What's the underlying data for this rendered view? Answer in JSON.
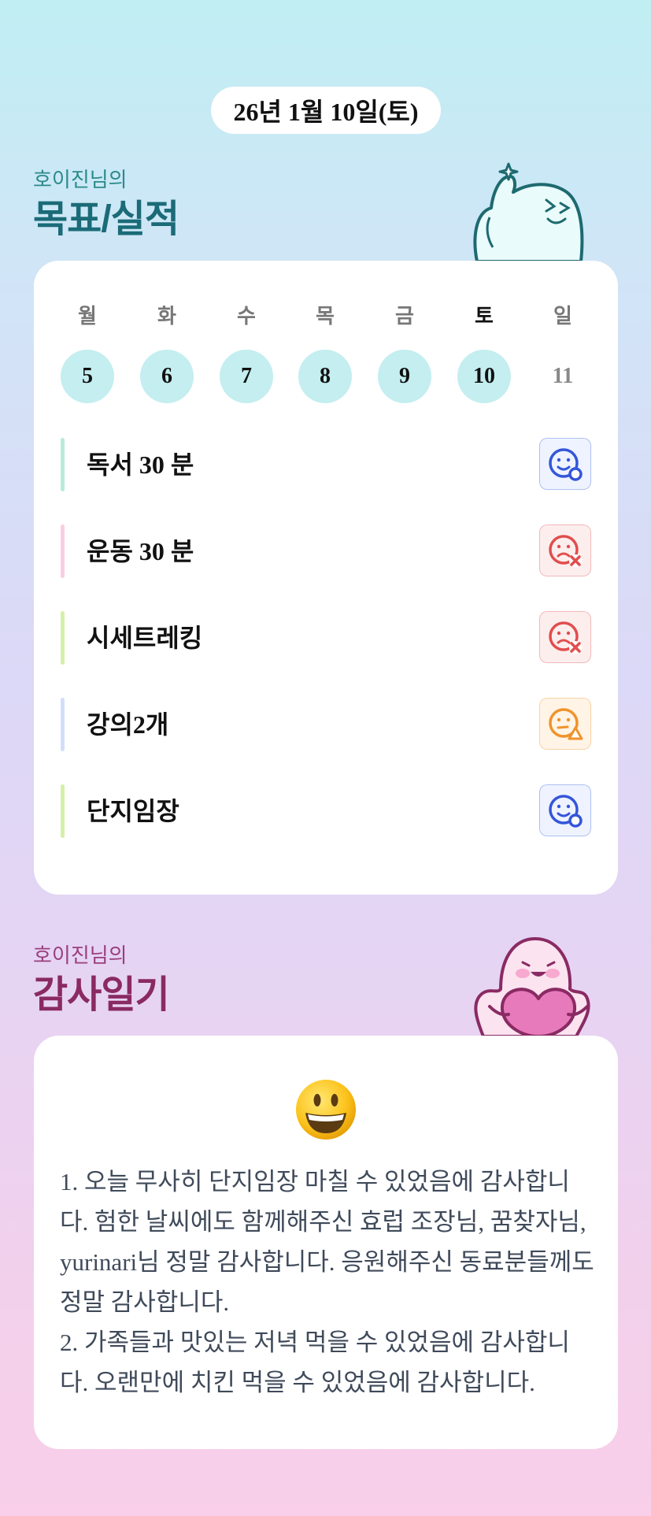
{
  "header": {
    "date": "26년 1월 10일(토)"
  },
  "goals_section": {
    "subtitle": "호이진님의",
    "title": "목표/실적",
    "week": [
      {
        "label": "월",
        "num": "5",
        "state": "done"
      },
      {
        "label": "화",
        "num": "6",
        "state": "done"
      },
      {
        "label": "수",
        "num": "7",
        "state": "done"
      },
      {
        "label": "목",
        "num": "8",
        "state": "done"
      },
      {
        "label": "금",
        "num": "9",
        "state": "done"
      },
      {
        "label": "토",
        "num": "10",
        "state": "today"
      },
      {
        "label": "일",
        "num": "11",
        "state": "future"
      }
    ],
    "goals": [
      {
        "text": "독서 30 분",
        "bar_color": "#b8ebd9",
        "status": "success",
        "icon": "smile-circle-icon",
        "icon_color": "#3456d9",
        "icon_bg": "#eef3ff"
      },
      {
        "text": "운동 30 분",
        "bar_color": "#f9cde3",
        "status": "fail",
        "icon": "sad-x-icon",
        "icon_color": "#e14e4e",
        "icon_bg": "#fdeeee"
      },
      {
        "text": "시세트레킹",
        "bar_color": "#d5f0a8",
        "status": "fail",
        "icon": "sad-x-icon",
        "icon_color": "#e14e4e",
        "icon_bg": "#fdeeee"
      },
      {
        "text": "강의2개",
        "bar_color": "#d2defa",
        "status": "partial",
        "icon": "neutral-triangle-icon",
        "icon_color": "#f0932b",
        "icon_bg": "#fff4e6"
      },
      {
        "text": "단지임장",
        "bar_color": "#d5f0a8",
        "status": "success",
        "icon": "smile-circle-icon",
        "icon_color": "#3456d9",
        "icon_bg": "#eef3ff"
      }
    ]
  },
  "gratitude_section": {
    "subtitle": "호이진님의",
    "title": "감사일기",
    "mood": "grinning-face-icon",
    "text": "1. 오늘 무사히 단지임장 마칠 수 있었음에 감사합니다. 험한 날씨에도 함께해주신 효럽 조장님, 꿈찾자님, yurinari님 정말 감사합니다. 응원해주신 동료분들께도 정말 감사합니다.\n2. 가족들과 맛있는 저녁 먹을 수 있었음에 감사합니다. 오랜만에 치킨 먹을 수 있었음에 감사합니다."
  }
}
